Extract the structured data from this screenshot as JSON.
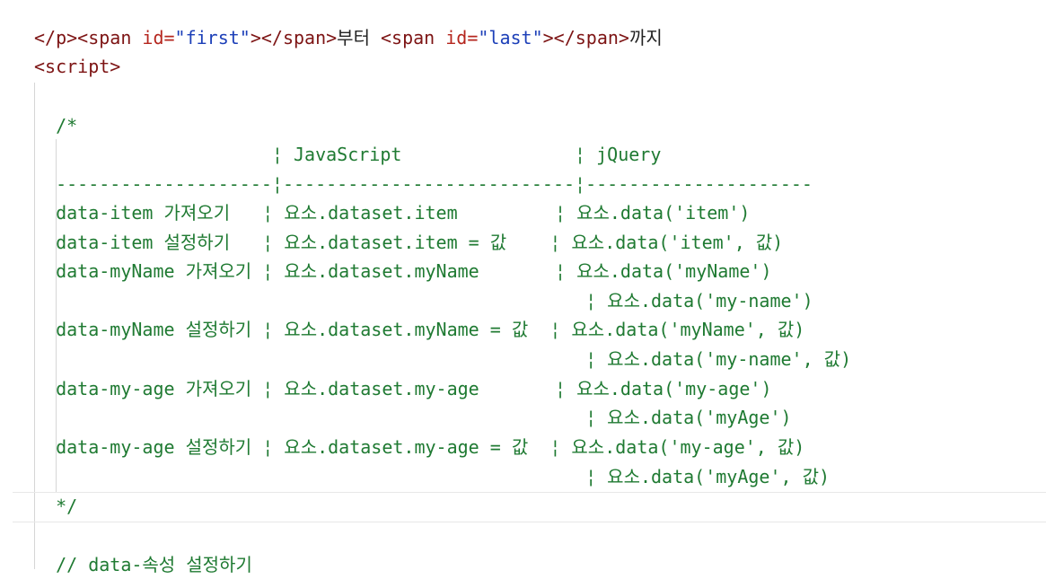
{
  "code": {
    "line_span": {
      "indent": "  ",
      "tag1_open": "<span ",
      "attr1": "id=",
      "val1": "\"first\"",
      "tag1_close": "></span>",
      "text1": "부터 ",
      "tag2_open": "<span ",
      "attr2": "id=",
      "val2": "\"last\"",
      "tag2_close": "></span>",
      "text2": "까지"
    },
    "line_p_close": "</p>",
    "line_script_open": "<script>",
    "comment_open": "  /*",
    "table_header": "                      ¦ JavaScript                ¦ jQuery",
    "table_divider": "  --------------------¦---------------------------¦---------------------",
    "rows": [
      "  data-item 가져오기   ¦ 요소.dataset.item         ¦ 요소.data('item')",
      "  data-item 설정하기   ¦ 요소.dataset.item = 값    ¦ 요소.data('item', 값)",
      "  data-myName 가져오기 ¦ 요소.dataset.myName       ¦ 요소.data('myName')",
      "                                                   ¦ 요소.data('my-name')",
      "  data-myName 설정하기 ¦ 요소.dataset.myName = 값  ¦ 요소.data('myName', 값)",
      "                                                   ¦ 요소.data('my-name', 값)",
      "  data-my-age 가져오기 ¦ 요소.dataset.my-age       ¦ 요소.data('my-age')",
      "                                                   ¦ 요소.data('myAge')",
      "  data-my-age 설정하기 ¦ 요소.dataset.my-age = 값  ¦ 요소.data('my-age', 값)",
      "                                                   ¦ 요소.data('myAge', 값)"
    ],
    "comment_close": "  */",
    "last_comment": "  // data-속성 설정하기"
  }
}
